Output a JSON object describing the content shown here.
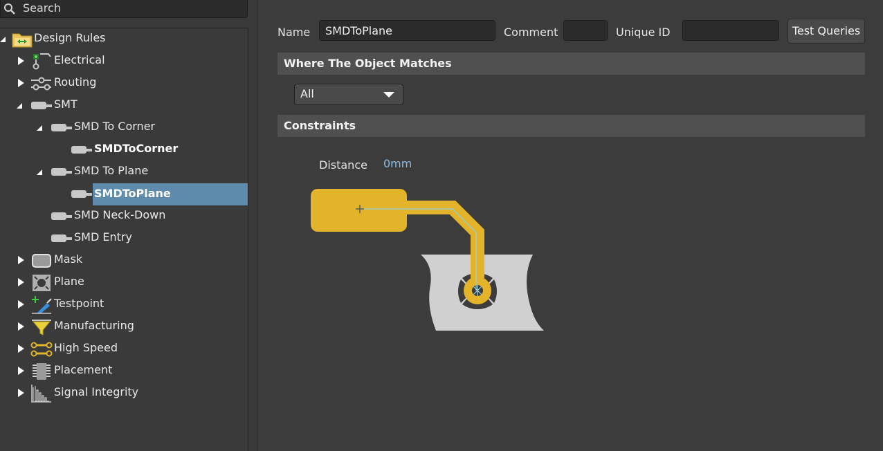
{
  "search": {
    "placeholder": "Search"
  },
  "tree": {
    "root": "Design Rules",
    "items": [
      {
        "label": "Electrical"
      },
      {
        "label": "Routing"
      },
      {
        "label": "SMT"
      },
      {
        "label": "SMD To Corner"
      },
      {
        "label": "SMDToCorner"
      },
      {
        "label": "SMD To Plane"
      },
      {
        "label": "SMDToPlane"
      },
      {
        "label": "SMD Neck-Down"
      },
      {
        "label": "SMD Entry"
      },
      {
        "label": "Mask"
      },
      {
        "label": "Plane"
      },
      {
        "label": "Testpoint"
      },
      {
        "label": "Manufacturing"
      },
      {
        "label": "High Speed"
      },
      {
        "label": "Placement"
      },
      {
        "label": "Signal Integrity"
      }
    ]
  },
  "form": {
    "name_label": "Name",
    "name_value": "SMDToPlane",
    "comment_label": "Comment",
    "comment_value": "",
    "uid_label": "Unique ID",
    "uid_value": "",
    "test_queries": "Test Queries"
  },
  "where": {
    "title": "Where The Object Matches",
    "selected": "All"
  },
  "constraints": {
    "title": "Constraints",
    "distance_label": "Distance",
    "distance_value": "0mm"
  },
  "colors": {
    "selection": "#5f8bad",
    "pad": "#e3b42a",
    "plane": "#d0d0d0",
    "value": "#8fb8e0"
  }
}
